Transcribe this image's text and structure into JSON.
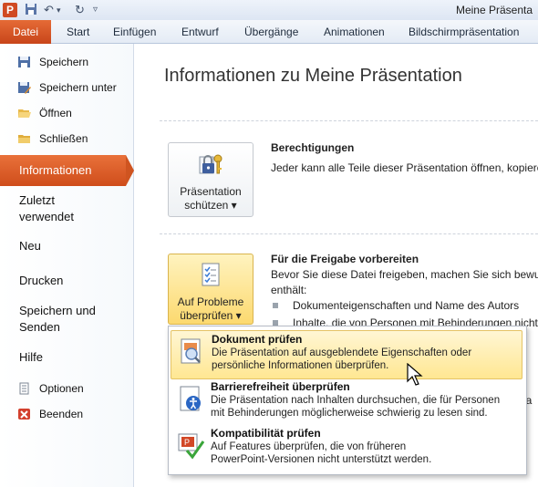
{
  "titlebar": {
    "app_icon_letter": "P",
    "title": "Meine Präsenta",
    "qat": [
      "save-icon",
      "undo-icon",
      "redo-icon",
      "customize-icon"
    ]
  },
  "ribbon": {
    "file_tab": "Datei",
    "tabs": [
      "Start",
      "Einfügen",
      "Entwurf",
      "Übergänge",
      "Animationen",
      "Bildschirmpräsentation"
    ]
  },
  "nav": {
    "save": "Speichern",
    "save_as": "Speichern unter",
    "open": "Öffnen",
    "close": "Schließen",
    "info": "Informationen",
    "recent_1": "Zuletzt",
    "recent_2": "verwendet",
    "new": "Neu",
    "print": "Drucken",
    "send_1": "Speichern und",
    "send_2": "Senden",
    "help": "Hilfe",
    "options": "Optionen",
    "exit": "Beenden"
  },
  "main": {
    "title": "Informationen zu Meine Präsentation",
    "permissions": {
      "button_line1": "Präsentation",
      "button_line2": "schützen ▾",
      "heading": "Berechtigungen",
      "text": "Jeder kann alle Teile dieser Präsentation öffnen, kopiere"
    },
    "prepare": {
      "button_line1": "Auf Probleme",
      "button_line2": "überprüfen ▾",
      "heading": "Für die Freigabe vorbereiten",
      "text_line1": "Bevor Sie diese Datei freigeben, machen Sie sich bewuss",
      "text_line2": "enthält:",
      "bullets": [
        "Dokumenteigenschaften und Name des Autors",
        "Inhalte, die von Personen mit Behinderungen nicht"
      ],
      "partial_text": "rha"
    }
  },
  "dropdown": {
    "items": [
      {
        "title": "Dokument prüfen",
        "desc1": "Die Präsentation auf ausgeblendete Eigenschaften oder",
        "desc2": "persönliche Informationen überprüfen."
      },
      {
        "title": "Barrierefreiheit überprüfen",
        "desc1": "Die Präsentation nach Inhalten durchsuchen, die für Personen",
        "desc2": "mit Behinderungen möglicherweise schwierig zu lesen sind."
      },
      {
        "title": "Kompatibilität prüfen",
        "desc1": "Auf Features überprüfen, die von früheren",
        "desc2": "PowerPoint-Versionen nicht unterstützt werden."
      }
    ]
  },
  "colors": {
    "accent": "#d85a26",
    "highlight": "#ffe792"
  }
}
